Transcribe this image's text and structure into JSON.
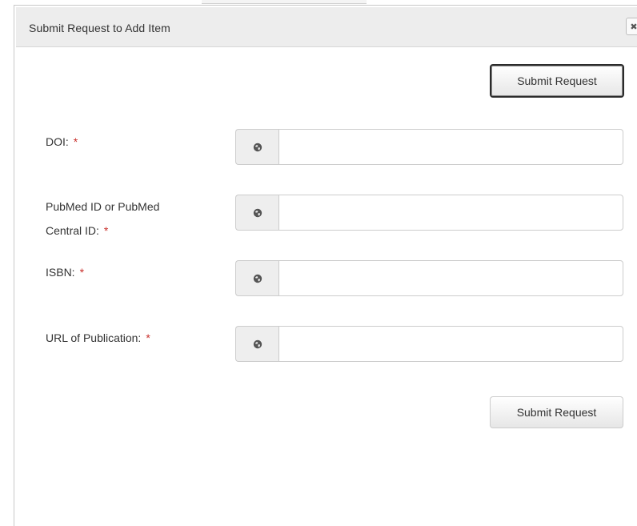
{
  "dialog": {
    "title": "Submit Request to Add Item",
    "close_label": "✖"
  },
  "buttons": {
    "submit_top": "Submit Request",
    "submit_bottom": "Submit Request"
  },
  "fields": [
    {
      "label": "DOI:",
      "required_marker": "*",
      "value": "",
      "placeholder": "",
      "icon": "globe-icon"
    },
    {
      "label_line1": "PubMed ID or PubMed",
      "label_line2": "Central ID:",
      "required_marker": "*",
      "value": "",
      "placeholder": "",
      "icon": "globe-icon"
    },
    {
      "label": "ISBN:",
      "required_marker": "*",
      "value": "",
      "placeholder": "",
      "icon": "globe-icon"
    },
    {
      "label": "URL of Publication:",
      "required_marker": "*",
      "value": "",
      "placeholder": "",
      "icon": "globe-icon"
    }
  ],
  "colors": {
    "required": "#c9302c",
    "titlebar_bg": "#ededed",
    "addon_bg": "#eeeeee"
  }
}
